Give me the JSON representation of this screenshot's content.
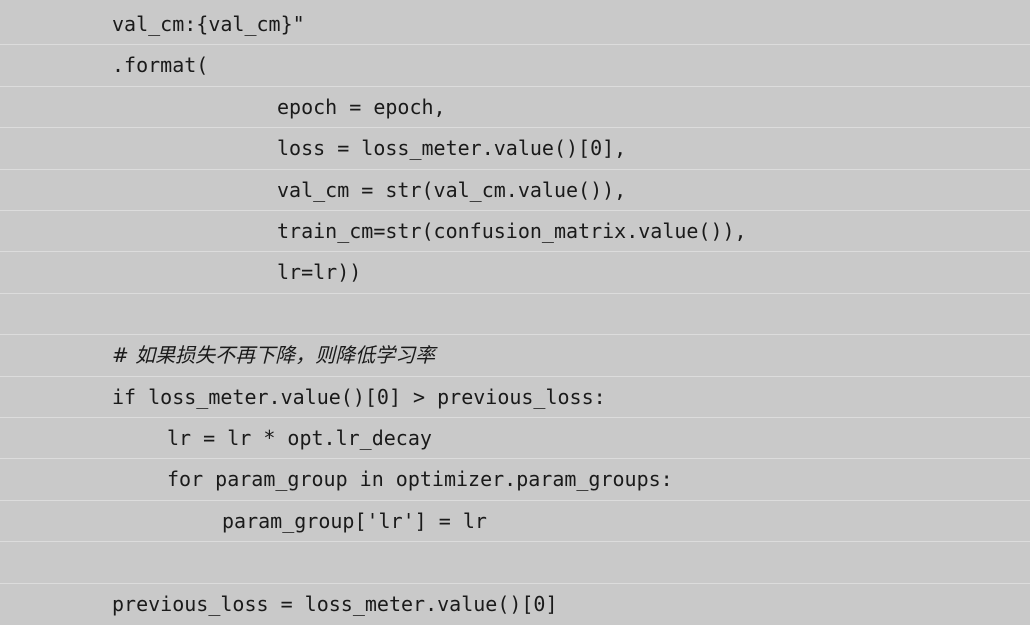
{
  "code": {
    "lines": [
      {
        "text": "val_cm:{val_cm}\"",
        "indent": 0
      },
      {
        "text": ".format(",
        "indent": 0
      },
      {
        "text": "epoch = epoch,",
        "indent": 3
      },
      {
        "text": "loss = loss_meter.value()[0],",
        "indent": 3
      },
      {
        "text": "val_cm = str(val_cm.value()),",
        "indent": 3
      },
      {
        "text": "train_cm=str(confusion_matrix.value()),",
        "indent": 3
      },
      {
        "text": "lr=lr))",
        "indent": 3
      },
      {
        "text": "",
        "indent": 0
      },
      {
        "text": "# 如果损失不再下降，则降低学习率",
        "indent": 0,
        "kind": "comment"
      },
      {
        "text": "if loss_meter.value()[0] > previous_loss:",
        "indent": 0
      },
      {
        "text": "lr = lr * opt.lr_decay",
        "indent": 1
      },
      {
        "text": "for param_group in optimizer.param_groups:",
        "indent": 1
      },
      {
        "text": "param_group['lr'] = lr",
        "indent": 2
      },
      {
        "text": "",
        "indent": 0
      },
      {
        "text": "previous_loss = loss_meter.value()[0]",
        "indent": 0
      }
    ]
  }
}
